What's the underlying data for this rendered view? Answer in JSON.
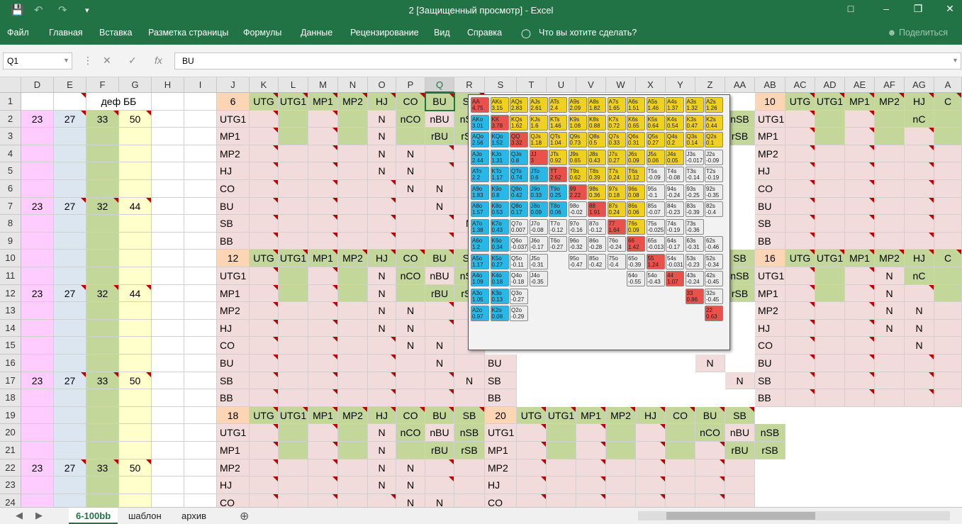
{
  "window": {
    "title": "2  [Защищенный просмотр]  -  Excel"
  },
  "ribbon": {
    "tabs": [
      "Файл",
      "Главная",
      "Вставка",
      "Разметка страницы",
      "Формулы",
      "Данные",
      "Рецензирование",
      "Вид",
      "Справка"
    ],
    "tell_me": "Что вы хотите сделать?",
    "share": "Поделиться"
  },
  "formula_bar": {
    "name_box": "Q1",
    "content": "BU"
  },
  "columns": [
    "D",
    "E",
    "F",
    "G",
    "H",
    "I",
    "J",
    "K",
    "L",
    "M",
    "N",
    "O",
    "P",
    "Q",
    "R",
    "S",
    "T",
    "U",
    "V",
    "W",
    "X",
    "Y",
    "Z",
    "AA",
    "AB",
    "AC",
    "AD",
    "AE",
    "AF",
    "AG",
    "A"
  ],
  "selected_column": "Q",
  "rows": [
    "1",
    "2",
    "3",
    "4",
    "5",
    "6",
    "7",
    "8",
    "9",
    "10",
    "11",
    "12",
    "13",
    "14",
    "15",
    "16",
    "17",
    "18",
    "19",
    "20",
    "21",
    "22",
    "23",
    "24"
  ],
  "left_block": {
    "header": "деф ББ",
    "rows": {
      "2": [
        "23",
        "27",
        "33",
        "50"
      ],
      "7": [
        "23",
        "27",
        "32",
        "44"
      ],
      "12": [
        "23",
        "27",
        "32",
        "44"
      ],
      "17": [
        "23",
        "27",
        "33",
        "50"
      ],
      "22": [
        "23",
        "27",
        "33",
        "50"
      ]
    }
  },
  "blocks": [
    {
      "id": "6",
      "positions": [
        "UTG",
        "UTG1",
        "MP1",
        "MP2",
        "HJ",
        "CO",
        "BU",
        "SB"
      ]
    },
    {
      "id": "10",
      "positions": [
        "UTG",
        "UTG1",
        "MP1",
        "MP2",
        "HJ",
        "C"
      ]
    },
    {
      "id": "12",
      "positions": [
        "UTG",
        "UTG1",
        "MP1",
        "MP2",
        "HJ",
        "CO",
        "BU",
        "SB"
      ]
    },
    {
      "id": "16",
      "positions": [
        "UTG",
        "UTG1",
        "MP1",
        "MP2",
        "HJ",
        "C"
      ]
    },
    {
      "id": "18",
      "positions": [
        "UTG",
        "UTG1",
        "MP1",
        "MP2",
        "HJ",
        "CO",
        "BU",
        "SB"
      ]
    },
    {
      "id": "20",
      "positions": [
        "UTG",
        "UTG1",
        "MP1",
        "MP2",
        "HJ",
        "CO",
        "BU",
        "SB"
      ]
    }
  ],
  "row_positions": [
    "UTG1",
    "MP1",
    "MP2",
    "HJ",
    "CO",
    "BU",
    "SB",
    "BB"
  ],
  "cell_marks": {
    "n": "N",
    "nco": "nCO",
    "nbu": "nBU",
    "nsb": "nSB",
    "rbu": "rBU",
    "rsb": "rSB",
    "sb": "SB",
    "co": "C",
    "nc": "nC",
    "ns": "S"
  },
  "hand_chart": [
    [
      "AA",
      "4.75",
      "r"
    ],
    [
      "AKs",
      "3.15",
      "y"
    ],
    [
      "AQs",
      "2.83",
      "y"
    ],
    [
      "AJs",
      "2.61",
      "y"
    ],
    [
      "ATs",
      "2.4",
      "y"
    ],
    [
      "A9s",
      "2.09",
      "y"
    ],
    [
      "A8s",
      "1.82",
      "y"
    ],
    [
      "A7s",
      "1.65",
      "y"
    ],
    [
      "A6s",
      "1.51",
      "y"
    ],
    [
      "A5s",
      "1.46",
      "y"
    ],
    [
      "A4s",
      "1.37",
      "y"
    ],
    [
      "A3s",
      "1.32",
      "y"
    ],
    [
      "A2s",
      "1.26",
      "y"
    ],
    [
      "AKo",
      "3.01",
      "b"
    ],
    [
      "KK",
      "3.78",
      "r"
    ],
    [
      "KQs",
      "1.62",
      "y"
    ],
    [
      "KJs",
      "1.6",
      "y"
    ],
    [
      "KTs",
      "1.46",
      "y"
    ],
    [
      "K9s",
      "1.08",
      "y"
    ],
    [
      "K8s",
      "0.88",
      "y"
    ],
    [
      "K7s",
      "0.72",
      "y"
    ],
    [
      "K6s",
      "0.65",
      "y"
    ],
    [
      "K5s",
      "0.64",
      "y"
    ],
    [
      "K4s",
      "0.54",
      "y"
    ],
    [
      "K3s",
      "0.47",
      "y"
    ],
    [
      "K2s",
      "0.44",
      "y"
    ],
    [
      "AQo",
      "2.56",
      "b"
    ],
    [
      "KQo",
      "1.52",
      "b"
    ],
    [
      "QQ",
      "3.32",
      "r"
    ],
    [
      "QJs",
      "1.18",
      "y"
    ],
    [
      "QTs",
      "1.04",
      "y"
    ],
    [
      "Q9s",
      "0.73",
      "y"
    ],
    [
      "Q8s",
      "0.5",
      "y"
    ],
    [
      "Q7s",
      "0.33",
      "y"
    ],
    [
      "Q6s",
      "0.31",
      "y"
    ],
    [
      "Q5s",
      "0.27",
      "y"
    ],
    [
      "Q4s",
      "0.2",
      "y"
    ],
    [
      "Q3s",
      "0.14",
      "y"
    ],
    [
      "Q2s",
      "0.1",
      "y"
    ],
    [
      "AJo",
      "2.44",
      "b"
    ],
    [
      "KJo",
      "1.31",
      "b"
    ],
    [
      "QJo",
      "0.8",
      "b"
    ],
    [
      "JJ",
      "3",
      "r"
    ],
    [
      "JTs",
      "0.92",
      "y"
    ],
    [
      "J9s",
      "0.65",
      "y"
    ],
    [
      "J8s",
      "0.43",
      "y"
    ],
    [
      "J7s",
      "0.27",
      "y"
    ],
    [
      "J6s",
      "0.09",
      "y"
    ],
    [
      "J5s",
      "0.06",
      "y"
    ],
    [
      "J4s",
      "0.05",
      "y"
    ],
    [
      "J3s",
      "-0.017",
      "w"
    ],
    [
      "J2s",
      "-0.09",
      "w"
    ],
    [
      "ATo",
      "2.2",
      "b"
    ],
    [
      "KTo",
      "1.17",
      "b"
    ],
    [
      "QTo",
      "0.74",
      "b"
    ],
    [
      "JTo",
      "0.6",
      "b"
    ],
    [
      "TT",
      "2.62",
      "r"
    ],
    [
      "T9s",
      "0.62",
      "y"
    ],
    [
      "T8s",
      "0.39",
      "y"
    ],
    [
      "T7s",
      "0.24",
      "y"
    ],
    [
      "T6s",
      "0.12",
      "y"
    ],
    [
      "T5s",
      "-0.09",
      "w"
    ],
    [
      "T4s",
      "-0.08",
      "w"
    ],
    [
      "T3s",
      "-0.14",
      "w"
    ],
    [
      "T2s",
      "-0.19",
      "w"
    ],
    [
      "A9o",
      "1.83",
      "b"
    ],
    [
      "K9o",
      "0.8",
      "b"
    ],
    [
      "Q9o",
      "0.42",
      "b"
    ],
    [
      "J9o",
      "0.33",
      "b"
    ],
    [
      "T9o",
      "0.25",
      "b"
    ],
    [
      "99",
      "2.22",
      "r"
    ],
    [
      "98s",
      "0.36",
      "y"
    ],
    [
      "97s",
      "0.18",
      "y"
    ],
    [
      "96s",
      "0.08",
      "y"
    ],
    [
      "95s",
      "-0.1",
      "w"
    ],
    [
      "94s",
      "-0.24",
      "w"
    ],
    [
      "93s",
      "-0.25",
      "w"
    ],
    [
      "92s",
      "-0.35",
      "w"
    ],
    [
      "A8o",
      "1.57",
      "b"
    ],
    [
      "K8o",
      "0.53",
      "b"
    ],
    [
      "Q8o",
      "0.17",
      "b"
    ],
    [
      "J8o",
      "0.09",
      "b"
    ],
    [
      "T8o",
      "0.06",
      "b"
    ],
    [
      "98o",
      "-0.02",
      "w"
    ],
    [
      "88",
      "1.91",
      "r"
    ],
    [
      "87s",
      "0.24",
      "y"
    ],
    [
      "86s",
      "0.06",
      "y"
    ],
    [
      "85s",
      "-0.07",
      "w"
    ],
    [
      "84s",
      "-0.23",
      "w"
    ],
    [
      "83s",
      "-0.39",
      "w"
    ],
    [
      "82s",
      "-0.4",
      "w"
    ],
    [
      "A7o",
      "1.38",
      "b"
    ],
    [
      "K7o",
      "0.43",
      "b"
    ],
    [
      "Q7o",
      "0.007",
      "w"
    ],
    [
      "J7o",
      "-0.08",
      "w"
    ],
    [
      "T7o",
      "-0.12",
      "w"
    ],
    [
      "97o",
      "-0.16",
      "w"
    ],
    [
      "87o",
      "-0.12",
      "w"
    ],
    [
      "77",
      "1.64",
      "r"
    ],
    [
      "76s",
      "0.09",
      "y"
    ],
    [
      "75s",
      "-0.025",
      "w"
    ],
    [
      "74s",
      "-0.19",
      "w"
    ],
    [
      "73s",
      "-0.36",
      "w"
    ],
    [
      "",
      "",
      " "
    ],
    [
      "A6o",
      "1.2",
      "b"
    ],
    [
      "K6o",
      "0.34",
      "b"
    ],
    [
      "Q6o",
      "-0.037",
      "w"
    ],
    [
      "J6o",
      "-0.17",
      "w"
    ],
    [
      "T6o",
      "-0.27",
      "w"
    ],
    [
      "96o",
      "-0.32",
      "w"
    ],
    [
      "86o",
      "-0.28",
      "w"
    ],
    [
      "76o",
      "-0.24",
      "w"
    ],
    [
      "66",
      "1.42",
      "r"
    ],
    [
      "65s",
      "-0.013",
      "w"
    ],
    [
      "64s",
      "-0.17",
      "w"
    ],
    [
      "63s",
      "-0.31",
      "w"
    ],
    [
      "62s",
      "-0.46",
      "w"
    ],
    [
      "A5o",
      "1.17",
      "b"
    ],
    [
      "K5o",
      "0.27",
      "b"
    ],
    [
      "Q5o",
      "-0.11",
      "w"
    ],
    [
      "J5o",
      "-0.31",
      "w"
    ],
    [
      "",
      "",
      " "
    ],
    [
      "95o",
      "-0.47",
      "w"
    ],
    [
      "85o",
      "-0.42",
      "w"
    ],
    [
      "75o",
      "-0.4",
      "w"
    ],
    [
      "65o",
      "-0.39",
      "w"
    ],
    [
      "55",
      "1.24",
      "r"
    ],
    [
      "54s",
      "-0.031",
      "w"
    ],
    [
      "53s",
      "-0.23",
      "w"
    ],
    [
      "52s",
      "-0.34",
      "w"
    ],
    [
      "A4o",
      "1.09",
      "b"
    ],
    [
      "K4o",
      "0.18",
      "b"
    ],
    [
      "Q4o",
      "-0.18",
      "w"
    ],
    [
      "J4o",
      "-0.35",
      "w"
    ],
    [
      "",
      "",
      " "
    ],
    [
      "",
      "",
      " "
    ],
    [
      "",
      "",
      " "
    ],
    [
      "",
      "",
      " "
    ],
    [
      "64o",
      "-0.55",
      "w"
    ],
    [
      "54o",
      "-0.43",
      "w"
    ],
    [
      "44",
      "1.07",
      "r"
    ],
    [
      "43s",
      "-0.24",
      "w"
    ],
    [
      "42s",
      "-0.45",
      "w"
    ],
    [
      "A3o",
      "1.05",
      "b"
    ],
    [
      "K3o",
      "0.13",
      "b"
    ],
    [
      "Q3o",
      "-0.27",
      "w"
    ],
    [
      "",
      "",
      " "
    ],
    [
      "",
      "",
      " "
    ],
    [
      "",
      "",
      " "
    ],
    [
      "",
      "",
      " "
    ],
    [
      "",
      "",
      " "
    ],
    [
      "",
      "",
      " "
    ],
    [
      "",
      "",
      " "
    ],
    [
      "",
      "",
      " "
    ],
    [
      "33",
      "0.86",
      "r"
    ],
    [
      "32s",
      "-0.45",
      "w"
    ],
    [
      "A2o",
      "0.97",
      "b"
    ],
    [
      "K2o",
      "0.08",
      "b"
    ],
    [
      "Q2o",
      "-0.29",
      "w"
    ],
    [
      "",
      "",
      " "
    ],
    [
      "",
      "",
      " "
    ],
    [
      "",
      "",
      " "
    ],
    [
      "",
      "",
      " "
    ],
    [
      "",
      "",
      " "
    ],
    [
      "",
      "",
      " "
    ],
    [
      "",
      "",
      " "
    ],
    [
      "",
      "",
      " "
    ],
    [
      "",
      "",
      " "
    ],
    [
      "22",
      "0.63",
      "r"
    ]
  ],
  "sheets": [
    "6-100bb",
    "шаблон",
    "архив"
  ],
  "active_sheet": "6-100bb",
  "colors": {
    "excel_green": "#217346",
    "pink": "#f2dcdb",
    "green": "#c4d79b",
    "blue": "#dce6f1",
    "yellow": "#ffffcc",
    "magenta": "#ffccff",
    "orange": "#fcd5b4"
  }
}
